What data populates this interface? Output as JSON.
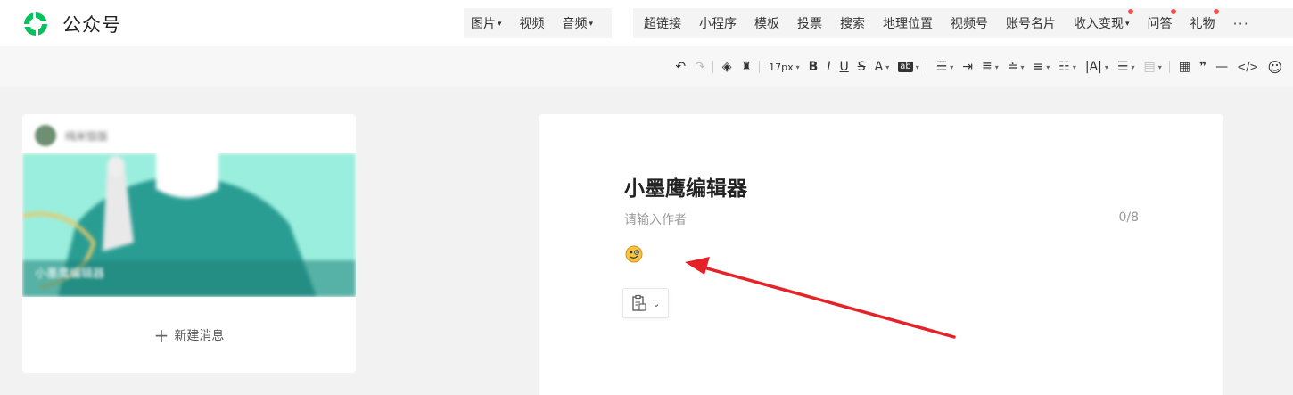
{
  "header": {
    "brand": "公众号",
    "media_tabs": [
      {
        "label": "图片",
        "caret": true
      },
      {
        "label": "视频",
        "caret": false
      },
      {
        "label": "音频",
        "caret": true
      }
    ],
    "insert_tabs": [
      {
        "label": "超链接",
        "dot": false,
        "caret": false
      },
      {
        "label": "小程序",
        "dot": false,
        "caret": false
      },
      {
        "label": "模板",
        "dot": false,
        "caret": false
      },
      {
        "label": "投票",
        "dot": false,
        "caret": false
      },
      {
        "label": "搜索",
        "dot": false,
        "caret": false
      },
      {
        "label": "地理位置",
        "dot": false,
        "caret": false
      },
      {
        "label": "视频号",
        "dot": false,
        "caret": false
      },
      {
        "label": "账号名片",
        "dot": false,
        "caret": false
      },
      {
        "label": "收入变现",
        "dot": true,
        "caret": true
      },
      {
        "label": "问答",
        "dot": true,
        "caret": false
      },
      {
        "label": "礼物",
        "dot": true,
        "caret": false
      }
    ],
    "more": "···",
    "colors": {
      "brand_green": "#07c160",
      "dot_red": "#f0524f"
    }
  },
  "toolbar": {
    "font_size": "17px",
    "icons": [
      "undo-icon",
      "redo-icon",
      "clear-format-icon",
      "format-brush-icon",
      "font-size-select",
      "bold-icon",
      "italic-icon",
      "underline-icon",
      "strikethrough-icon",
      "font-color-icon",
      "background-color-icon",
      "align-icon",
      "indent-icon",
      "paragraph-spacing-icon",
      "line-spacing-icon",
      "text-align-icon",
      "paragraph-icon",
      "letter-spacing-icon",
      "list-icon",
      "block-style-icon",
      "table-icon",
      "quote-icon",
      "divider-icon",
      "code-icon",
      "emoji-icon"
    ]
  },
  "sidebar": {
    "account_name": "纯米馅饭",
    "cover_caption": "小墨鹰编辑器",
    "new_message": "新建消息"
  },
  "editor": {
    "title": "小墨鹰编辑器",
    "author_placeholder": "请输入作者",
    "author_count": "0/8"
  }
}
